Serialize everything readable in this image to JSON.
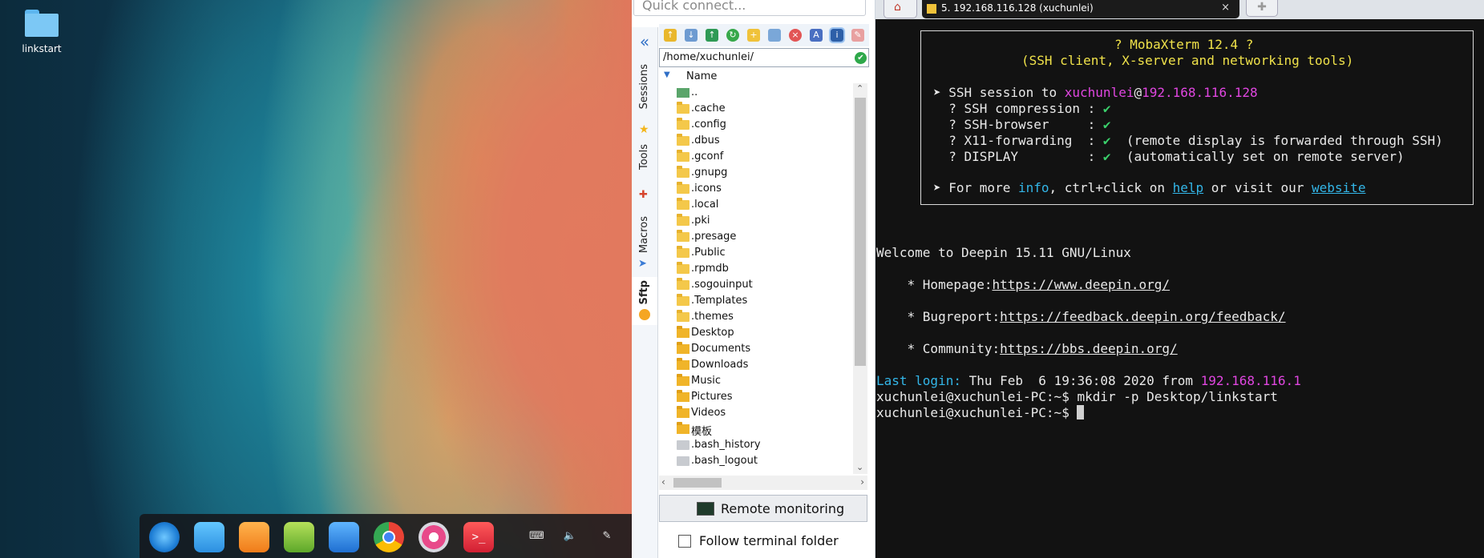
{
  "desktop": {
    "icon_label": "linkstart",
    "dock_apps": [
      "launcher-icon",
      "store-icon",
      "app-store-icon",
      "music-icon",
      "movie-icon",
      "chrome-icon",
      "settings-icon",
      "terminal-icon"
    ],
    "tray": [
      "keyboard-icon",
      "volume-icon",
      "brush-icon"
    ]
  },
  "mobaxterm": {
    "quick_connect_placeholder": "Quick connect...",
    "side_tabs": [
      "Sessions",
      "Tools",
      "Macros",
      "Sftp"
    ],
    "path": "/home/xuchunlei/",
    "column_name": "Name",
    "files": [
      {
        "name": "..",
        "type": "up"
      },
      {
        "name": ".cache",
        "type": "folder"
      },
      {
        "name": ".config",
        "type": "folder"
      },
      {
        "name": ".dbus",
        "type": "folder"
      },
      {
        "name": ".gconf",
        "type": "folder"
      },
      {
        "name": ".gnupg",
        "type": "folder"
      },
      {
        "name": ".icons",
        "type": "folder"
      },
      {
        "name": ".local",
        "type": "folder"
      },
      {
        "name": ".pki",
        "type": "folder"
      },
      {
        "name": ".presage",
        "type": "folder"
      },
      {
        "name": ".Public",
        "type": "folder"
      },
      {
        "name": ".rpmdb",
        "type": "folder"
      },
      {
        "name": ".sogouinput",
        "type": "folder"
      },
      {
        "name": ".Templates",
        "type": "folder"
      },
      {
        "name": ".themes",
        "type": "folder"
      },
      {
        "name": "Desktop",
        "type": "solid"
      },
      {
        "name": "Documents",
        "type": "solid"
      },
      {
        "name": "Downloads",
        "type": "solid"
      },
      {
        "name": "Music",
        "type": "solid"
      },
      {
        "name": "Pictures",
        "type": "solid"
      },
      {
        "name": "Videos",
        "type": "solid"
      },
      {
        "name": "模板",
        "type": "solid"
      },
      {
        "name": ".bash_history",
        "type": "file"
      },
      {
        "name": ".bash_logout",
        "type": "file"
      }
    ],
    "remote_monitoring": "Remote monitoring",
    "follow_terminal": "Follow terminal folder"
  },
  "terminal": {
    "tab_title": "5. 192.168.116.128 (xuchunlei)",
    "banner": {
      "title": "? MobaXterm 12.4 ?",
      "subtitle": "(SSH client, X-server and networking tools)",
      "session_prefix": "➤ SSH session to ",
      "user": "xuchunlei",
      "at": "@",
      "host": "192.168.116.128",
      "items": [
        {
          "label": "  ? SSH compression : ",
          "check": "✔",
          "note": ""
        },
        {
          "label": "  ? SSH-browser     : ",
          "check": "✔",
          "note": ""
        },
        {
          "label": "  ? X11-forwarding  : ",
          "check": "✔",
          "note": "  (remote display is forwarded through SSH)"
        },
        {
          "label": "  ? DISPLAY         : ",
          "check": "✔",
          "note": "  (automatically set on remote server)"
        }
      ],
      "more_prefix": "➤ For more ",
      "info": "info",
      "more_mid": ", ctrl+click on ",
      "help": "help",
      "more_mid2": " or visit our ",
      "website": "website"
    },
    "welcome": "Welcome to Deepin 15.11 GNU/Linux",
    "homepage_label": "    * Homepage:",
    "homepage_url": "https://www.deepin.org/",
    "bugreport_label": "    * Bugreport:",
    "bugreport_url": "https://feedback.deepin.org/feedback/",
    "community_label": "    * Community:",
    "community_url": "https://bbs.deepin.org/",
    "last_login_label": "Last login:",
    "last_login_text": " Thu Feb  6 19:36:08 2020 from ",
    "last_login_ip": "192.168.116.1",
    "prompt1": "xuchunlei@xuchunlei-PC:~$ mkdir -p Desktop/linkstart",
    "prompt2": "xuchunlei@xuchunlei-PC:~$ "
  }
}
